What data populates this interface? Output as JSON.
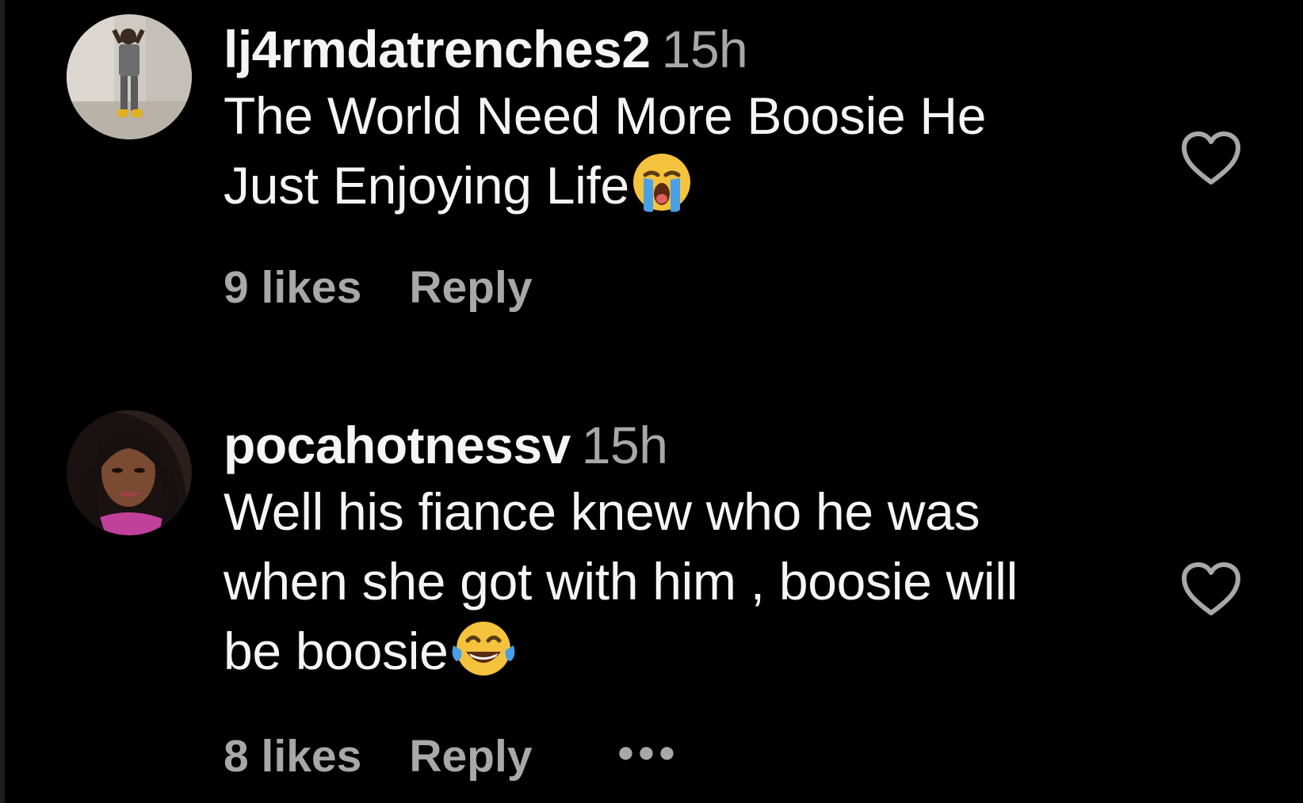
{
  "comments": [
    {
      "username": "lj4rmdatrenches2",
      "time": "15h",
      "text_line1": "The World Need More Boosie He",
      "text_line2": "Just Enjoying Life",
      "emoji": "loudly-crying-face",
      "likes": "9 likes",
      "reply": "Reply"
    },
    {
      "username": "pocahotnessv",
      "time": "15h",
      "text_line1": "Well his fiance knew who he was",
      "text_line2": "when she got with him , boosie will",
      "text_line3": "be boosie",
      "emoji": "face-with-tears-of-joy",
      "likes": "8 likes",
      "reply": "Reply",
      "more": "•••"
    }
  ],
  "icons": {
    "like": "heart-outline-icon"
  },
  "colors": {
    "background": "#000000",
    "primary_text": "#f5f5f5",
    "secondary_text": "#a8a8a8"
  }
}
